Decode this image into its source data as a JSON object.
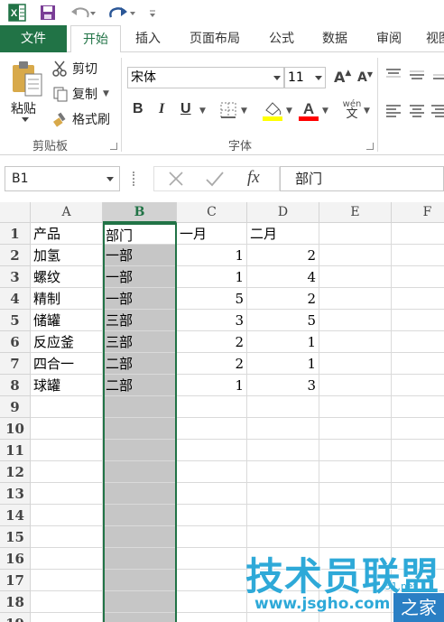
{
  "quick_access": {
    "excel_icon": "excel-icon",
    "save_icon": "save-icon",
    "undo_icon": "undo-icon",
    "redo_icon": "redo-icon",
    "more_icon": "customize-qat-icon"
  },
  "tabs": [
    {
      "label": "文件"
    },
    {
      "label": "开始"
    },
    {
      "label": "插入"
    },
    {
      "label": "页面布局"
    },
    {
      "label": "公式"
    },
    {
      "label": "数据"
    },
    {
      "label": "审阅"
    },
    {
      "label": "视图"
    }
  ],
  "ribbon": {
    "clipboard": {
      "paste_label": "粘贴",
      "cut_label": "剪切",
      "copy_label": "复制",
      "format_painter_label": "格式刷",
      "group_label": "剪贴板"
    },
    "font": {
      "font_name": "宋体",
      "font_size": "11",
      "bold": "B",
      "italic": "I",
      "underline": "U",
      "wen": "wén",
      "wen_zh": "文",
      "group_label": "字体",
      "fill_color": "#ffff00",
      "font_color": "#ff0000"
    }
  },
  "formula_bar": {
    "name_box": "B1",
    "fx_label": "fx",
    "content": "部门"
  },
  "columns": [
    "A",
    "B",
    "C",
    "D",
    "E",
    "F"
  ],
  "rows": [
    "1",
    "2",
    "3",
    "4",
    "5",
    "6",
    "7",
    "8",
    "9",
    "10",
    "11",
    "12",
    "13",
    "14",
    "15",
    "16",
    "17",
    "18",
    "19"
  ],
  "sheet": {
    "headers": [
      "产品",
      "部门",
      "一月",
      "二月"
    ],
    "data": [
      [
        "加氢",
        "一部",
        "1",
        "2"
      ],
      [
        "螺纹",
        "一部",
        "1",
        "4"
      ],
      [
        "精制",
        "一部",
        "5",
        "2"
      ],
      [
        "储罐",
        "三部",
        "3",
        "5"
      ],
      [
        "反应釜",
        "三部",
        "2",
        "1"
      ],
      [
        "四合一",
        "二部",
        "2",
        "1"
      ],
      [
        "球罐",
        "二部",
        "1",
        "3"
      ]
    ]
  },
  "watermark": {
    "title": "技术员联盟",
    "url": "www.jsgho.com",
    "tag": "51.net",
    "zh": "之家"
  },
  "colors": {
    "accent": "#217346",
    "selection": "#c6c6c6"
  }
}
